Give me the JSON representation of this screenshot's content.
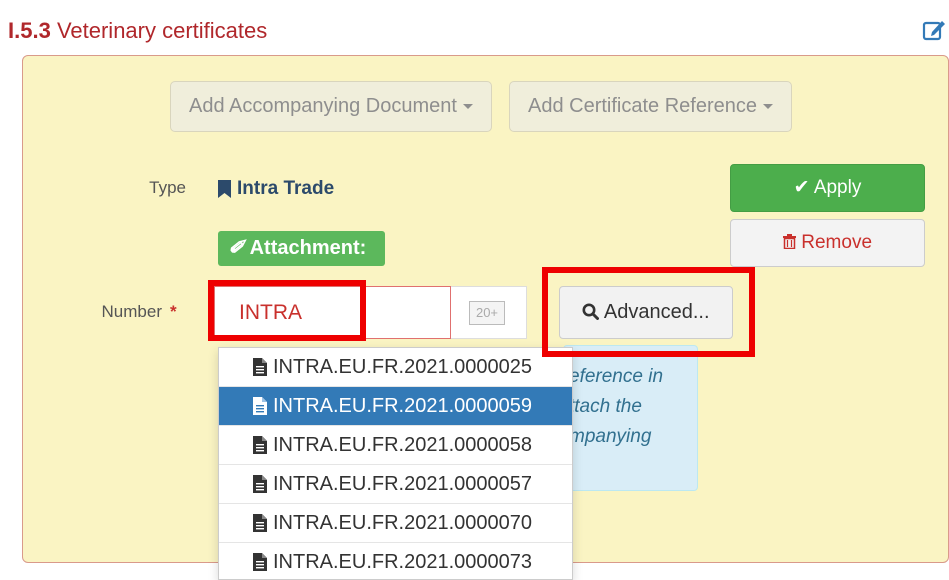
{
  "section": {
    "number": "I.5.3",
    "title": "Veterinary certificates"
  },
  "toolbar": {
    "add_document_label": "Add Accompanying Document",
    "add_certificate_label": "Add Certificate Reference"
  },
  "form": {
    "type_label": "Type",
    "type_value": "Intra Trade",
    "attachment_label": "Attachment:",
    "number_label": "Number",
    "required_mark": "*",
    "number_value": "INTRA",
    "results_count": "20+",
    "advanced_label": "Advanced..."
  },
  "actions": {
    "apply_label": "Apply",
    "remove_label": "Remove"
  },
  "info_text": "eference in ttach the mpanying",
  "dropdown": {
    "selected_index": 1,
    "items": [
      "INTRA.EU.FR.2021.0000025",
      "INTRA.EU.FR.2021.0000059",
      "INTRA.EU.FR.2021.0000058",
      "INTRA.EU.FR.2021.0000057",
      "INTRA.EU.FR.2021.0000070",
      "INTRA.EU.FR.2021.0000073"
    ]
  },
  "colors": {
    "title": "#b0272b",
    "apply": "#4cae4c",
    "selected": "#337ab7",
    "highlight": "#ee0000"
  }
}
